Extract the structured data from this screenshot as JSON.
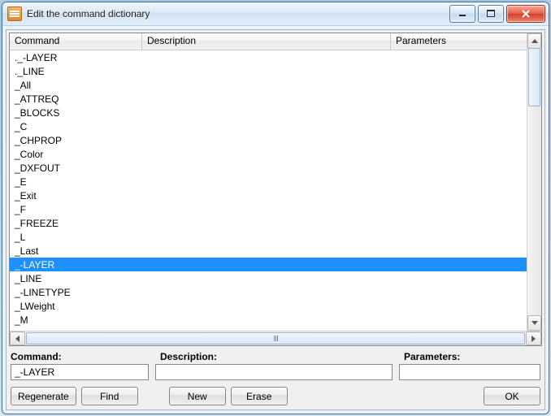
{
  "window": {
    "title": "Edit the command dictionary"
  },
  "columns": {
    "command": "Command",
    "description": "Description",
    "parameters": "Parameters"
  },
  "rows": [
    {
      "command": "._-LAYER",
      "description": "",
      "parameters": ""
    },
    {
      "command": "._LINE",
      "description": "",
      "parameters": ""
    },
    {
      "command": "_All",
      "description": "",
      "parameters": ""
    },
    {
      "command": "_ATTREQ",
      "description": "",
      "parameters": ""
    },
    {
      "command": "_BLOCKS",
      "description": "",
      "parameters": ""
    },
    {
      "command": "_C",
      "description": "",
      "parameters": ""
    },
    {
      "command": "_CHPROP",
      "description": "",
      "parameters": ""
    },
    {
      "command": "_Color",
      "description": "",
      "parameters": ""
    },
    {
      "command": "_DXFOUT",
      "description": "",
      "parameters": ""
    },
    {
      "command": "_E",
      "description": "",
      "parameters": ""
    },
    {
      "command": "_Exit",
      "description": "",
      "parameters": ""
    },
    {
      "command": "_F",
      "description": "",
      "parameters": ""
    },
    {
      "command": "_FREEZE",
      "description": "",
      "parameters": ""
    },
    {
      "command": "_L",
      "description": "",
      "parameters": ""
    },
    {
      "command": "_Last",
      "description": "",
      "parameters": ""
    },
    {
      "command": "_-LAYER",
      "description": "",
      "parameters": ""
    },
    {
      "command": "_LINE",
      "description": "",
      "parameters": ""
    },
    {
      "command": "_-LINETYPE",
      "description": "",
      "parameters": ""
    },
    {
      "command": "_LWeight",
      "description": "",
      "parameters": ""
    },
    {
      "command": "_M",
      "description": "",
      "parameters": ""
    }
  ],
  "selected_index": 15,
  "labels": {
    "command": "Command:",
    "description": "Description:",
    "parameters": "Parameters:"
  },
  "inputs": {
    "command": "_-LAYER",
    "description": "",
    "parameters": ""
  },
  "buttons": {
    "regenerate": "Regenerate",
    "find": "Find",
    "new": "New",
    "erase": "Erase",
    "ok": "OK"
  }
}
